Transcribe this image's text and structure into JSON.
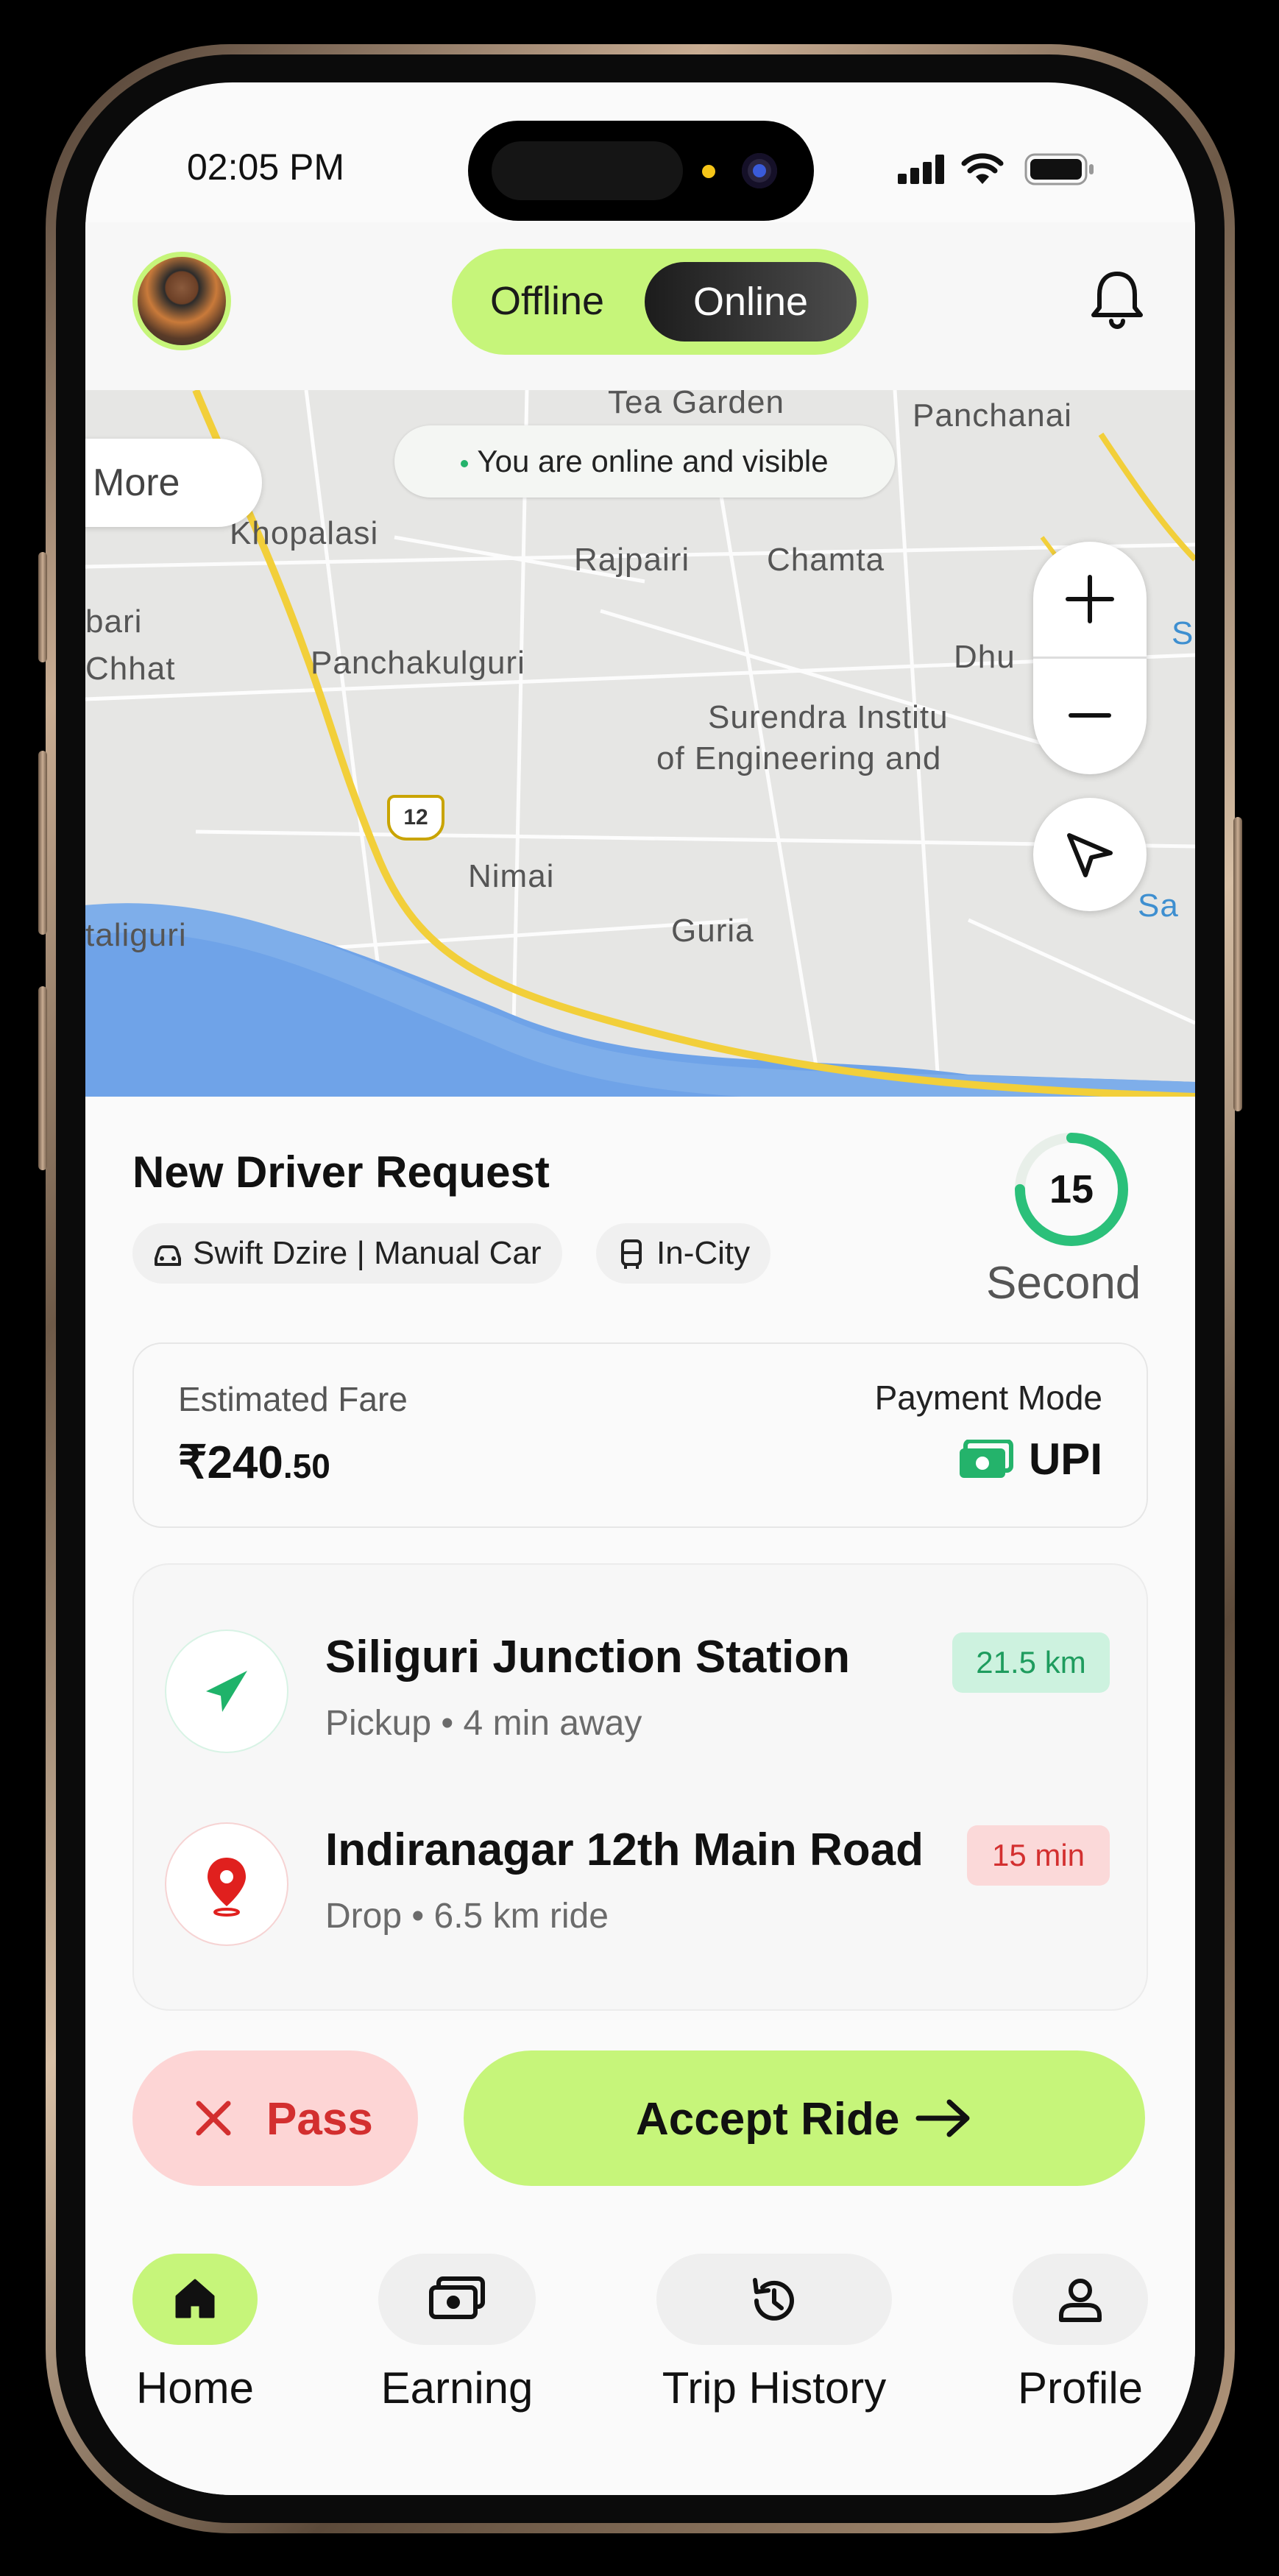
{
  "status_bar": {
    "time": "02:05 PM"
  },
  "header": {
    "toggle_offline": "Offline",
    "toggle_online": "Online",
    "avatar": "driver-avatar",
    "bell": "bell-icon"
  },
  "map": {
    "status_text": "You are online and visible",
    "more_label": "More",
    "labels": [
      "Tea Garden",
      "Panchanai",
      "Khopalasi",
      "Rajpairi",
      "Chamta",
      "Panchakulguri",
      "Dhu",
      "Surendra Institu",
      "of Engineering and",
      "Nimai",
      "Guria",
      "taliguri",
      "bari",
      "Chhat",
      "Sa",
      "S"
    ],
    "highway": "12"
  },
  "request": {
    "title": "New Driver Request",
    "car_chip": "Swift Dzire | Manual Car",
    "trip_chip": "In-City",
    "timer_value": "15",
    "timer_unit": "Second",
    "timer_fraction": 0.75
  },
  "fare": {
    "label": "Estimated Fare",
    "currency": "₹",
    "amount_main": "240",
    "amount_decimal": ".50",
    "payment_label": "Payment Mode",
    "payment_value": "UPI"
  },
  "route": {
    "pickup": {
      "name": "Siliguri Junction Station",
      "detail": "Pickup • 4 min away",
      "badge": "21.5 km"
    },
    "drop": {
      "name": "Indiranagar 12th Main Road",
      "detail": "Drop • 6.5 km ride",
      "badge": "15 min"
    }
  },
  "actions": {
    "pass": "Pass",
    "accept": "Accept Ride"
  },
  "nav": [
    {
      "label": "Home",
      "icon": "home-icon",
      "active": true
    },
    {
      "label": "Earning",
      "icon": "wallet-icon",
      "active": false
    },
    {
      "label": "Trip History",
      "icon": "history-icon",
      "active": false
    },
    {
      "label": "Profile",
      "icon": "profile-icon",
      "active": false
    }
  ],
  "colors": {
    "accent": "#c6f57a",
    "green": "#24b36b",
    "red": "#d32f2f"
  }
}
